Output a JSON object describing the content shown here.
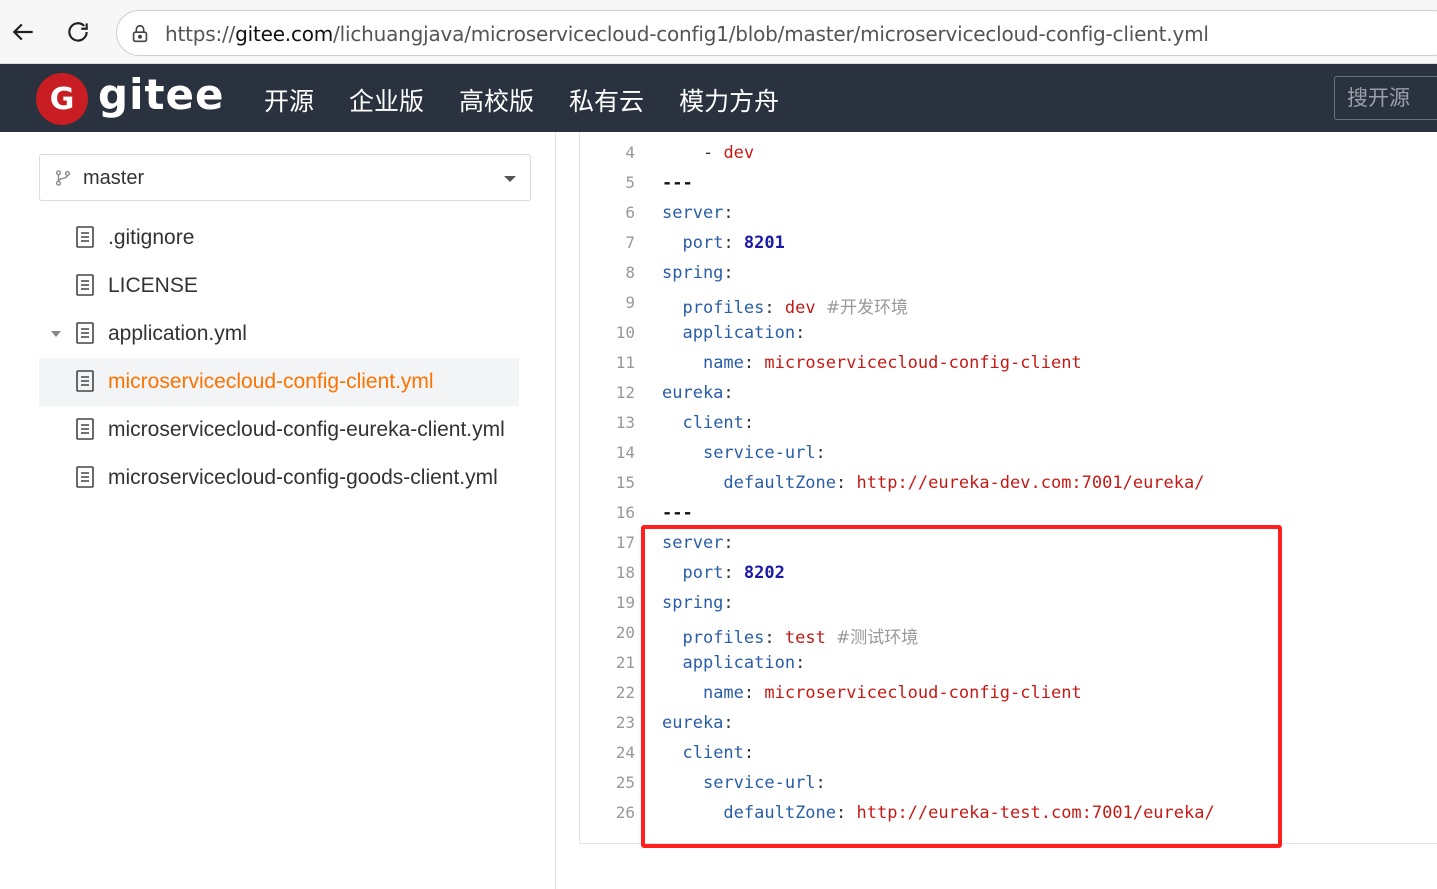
{
  "browser": {
    "url_prefix": "https://",
    "url_host": "gitee.com",
    "url_path": "/lichuangjava/microservicecloud-config1/blob/master/microservicecloud-config-client.yml"
  },
  "header": {
    "logo_letter": "G",
    "logo_text": "gitee",
    "nav": [
      "开源",
      "企业版",
      "高校版",
      "私有云",
      "模力方舟"
    ],
    "search_placeholder": "搜开源"
  },
  "sidebar": {
    "branch": "master",
    "files": [
      {
        "name": ".gitignore"
      },
      {
        "name": "LICENSE"
      },
      {
        "name": "application.yml"
      },
      {
        "name": "microservicecloud-config-client.yml"
      },
      {
        "name": "microservicecloud-config-eureka-client.yml"
      },
      {
        "name": "microservicecloud-config-goods-client.yml"
      }
    ]
  },
  "code": {
    "lines": [
      {
        "n": "4",
        "indent": "    ",
        "parts": [
          [
            "p",
            "- "
          ],
          [
            "s",
            "dev"
          ]
        ]
      },
      {
        "n": "5",
        "indent": "",
        "parts": [
          [
            "d",
            "---"
          ]
        ]
      },
      {
        "n": "6",
        "indent": "",
        "parts": [
          [
            "k",
            "server"
          ],
          [
            "p",
            ":"
          ]
        ]
      },
      {
        "n": "7",
        "indent": "  ",
        "parts": [
          [
            "k",
            "port"
          ],
          [
            "p",
            ": "
          ],
          [
            "n",
            "8201"
          ]
        ]
      },
      {
        "n": "8",
        "indent": "",
        "parts": [
          [
            "k",
            "spring"
          ],
          [
            "p",
            ":"
          ]
        ]
      },
      {
        "n": "9",
        "indent": "  ",
        "parts": [
          [
            "k",
            "profiles"
          ],
          [
            "p",
            ": "
          ],
          [
            "s",
            "dev "
          ],
          [
            "c",
            "#开发环境"
          ]
        ]
      },
      {
        "n": "10",
        "indent": "  ",
        "parts": [
          [
            "k",
            "application"
          ],
          [
            "p",
            ":"
          ]
        ]
      },
      {
        "n": "11",
        "indent": "    ",
        "parts": [
          [
            "k",
            "name"
          ],
          [
            "p",
            ": "
          ],
          [
            "s",
            "microservicecloud-config-client"
          ]
        ]
      },
      {
        "n": "12",
        "indent": "",
        "parts": [
          [
            "k",
            "eureka"
          ],
          [
            "p",
            ":"
          ]
        ]
      },
      {
        "n": "13",
        "indent": "  ",
        "parts": [
          [
            "k",
            "client"
          ],
          [
            "p",
            ":"
          ]
        ]
      },
      {
        "n": "14",
        "indent": "    ",
        "parts": [
          [
            "k",
            "service-url"
          ],
          [
            "p",
            ":"
          ]
        ]
      },
      {
        "n": "15",
        "indent": "      ",
        "parts": [
          [
            "k",
            "defaultZone"
          ],
          [
            "p",
            ": "
          ],
          [
            "s",
            "http://eureka-dev.com:7001/eureka/"
          ]
        ]
      },
      {
        "n": "16",
        "indent": "",
        "parts": [
          [
            "d",
            "---"
          ]
        ]
      },
      {
        "n": "17",
        "indent": "",
        "parts": [
          [
            "k",
            "server"
          ],
          [
            "p",
            ":"
          ]
        ]
      },
      {
        "n": "18",
        "indent": "  ",
        "parts": [
          [
            "k",
            "port"
          ],
          [
            "p",
            ": "
          ],
          [
            "n",
            "8202"
          ]
        ]
      },
      {
        "n": "19",
        "indent": "",
        "parts": [
          [
            "k",
            "spring"
          ],
          [
            "p",
            ":"
          ]
        ]
      },
      {
        "n": "20",
        "indent": "  ",
        "parts": [
          [
            "k",
            "profiles"
          ],
          [
            "p",
            ": "
          ],
          [
            "s",
            "test "
          ],
          [
            "c",
            "#测试环境"
          ]
        ]
      },
      {
        "n": "21",
        "indent": "  ",
        "parts": [
          [
            "k",
            "application"
          ],
          [
            "p",
            ":"
          ]
        ]
      },
      {
        "n": "22",
        "indent": "    ",
        "parts": [
          [
            "k",
            "name"
          ],
          [
            "p",
            ": "
          ],
          [
            "s",
            "microservicecloud-config-client"
          ]
        ]
      },
      {
        "n": "23",
        "indent": "",
        "parts": [
          [
            "k",
            "eureka"
          ],
          [
            "p",
            ":"
          ]
        ]
      },
      {
        "n": "24",
        "indent": "  ",
        "parts": [
          [
            "k",
            "client"
          ],
          [
            "p",
            ":"
          ]
        ]
      },
      {
        "n": "25",
        "indent": "    ",
        "parts": [
          [
            "k",
            "service-url"
          ],
          [
            "p",
            ":"
          ]
        ]
      },
      {
        "n": "26",
        "indent": "      ",
        "parts": [
          [
            "k",
            "defaultZone"
          ],
          [
            "p",
            ": "
          ],
          [
            "s",
            "http://eureka-test.com:7001/eureka/"
          ]
        ]
      }
    ]
  },
  "colors": {
    "header_bg": "#2a3240",
    "logo_red": "#c71d23",
    "active_file": "#fe7300",
    "highlight": "#ff1f1f"
  }
}
